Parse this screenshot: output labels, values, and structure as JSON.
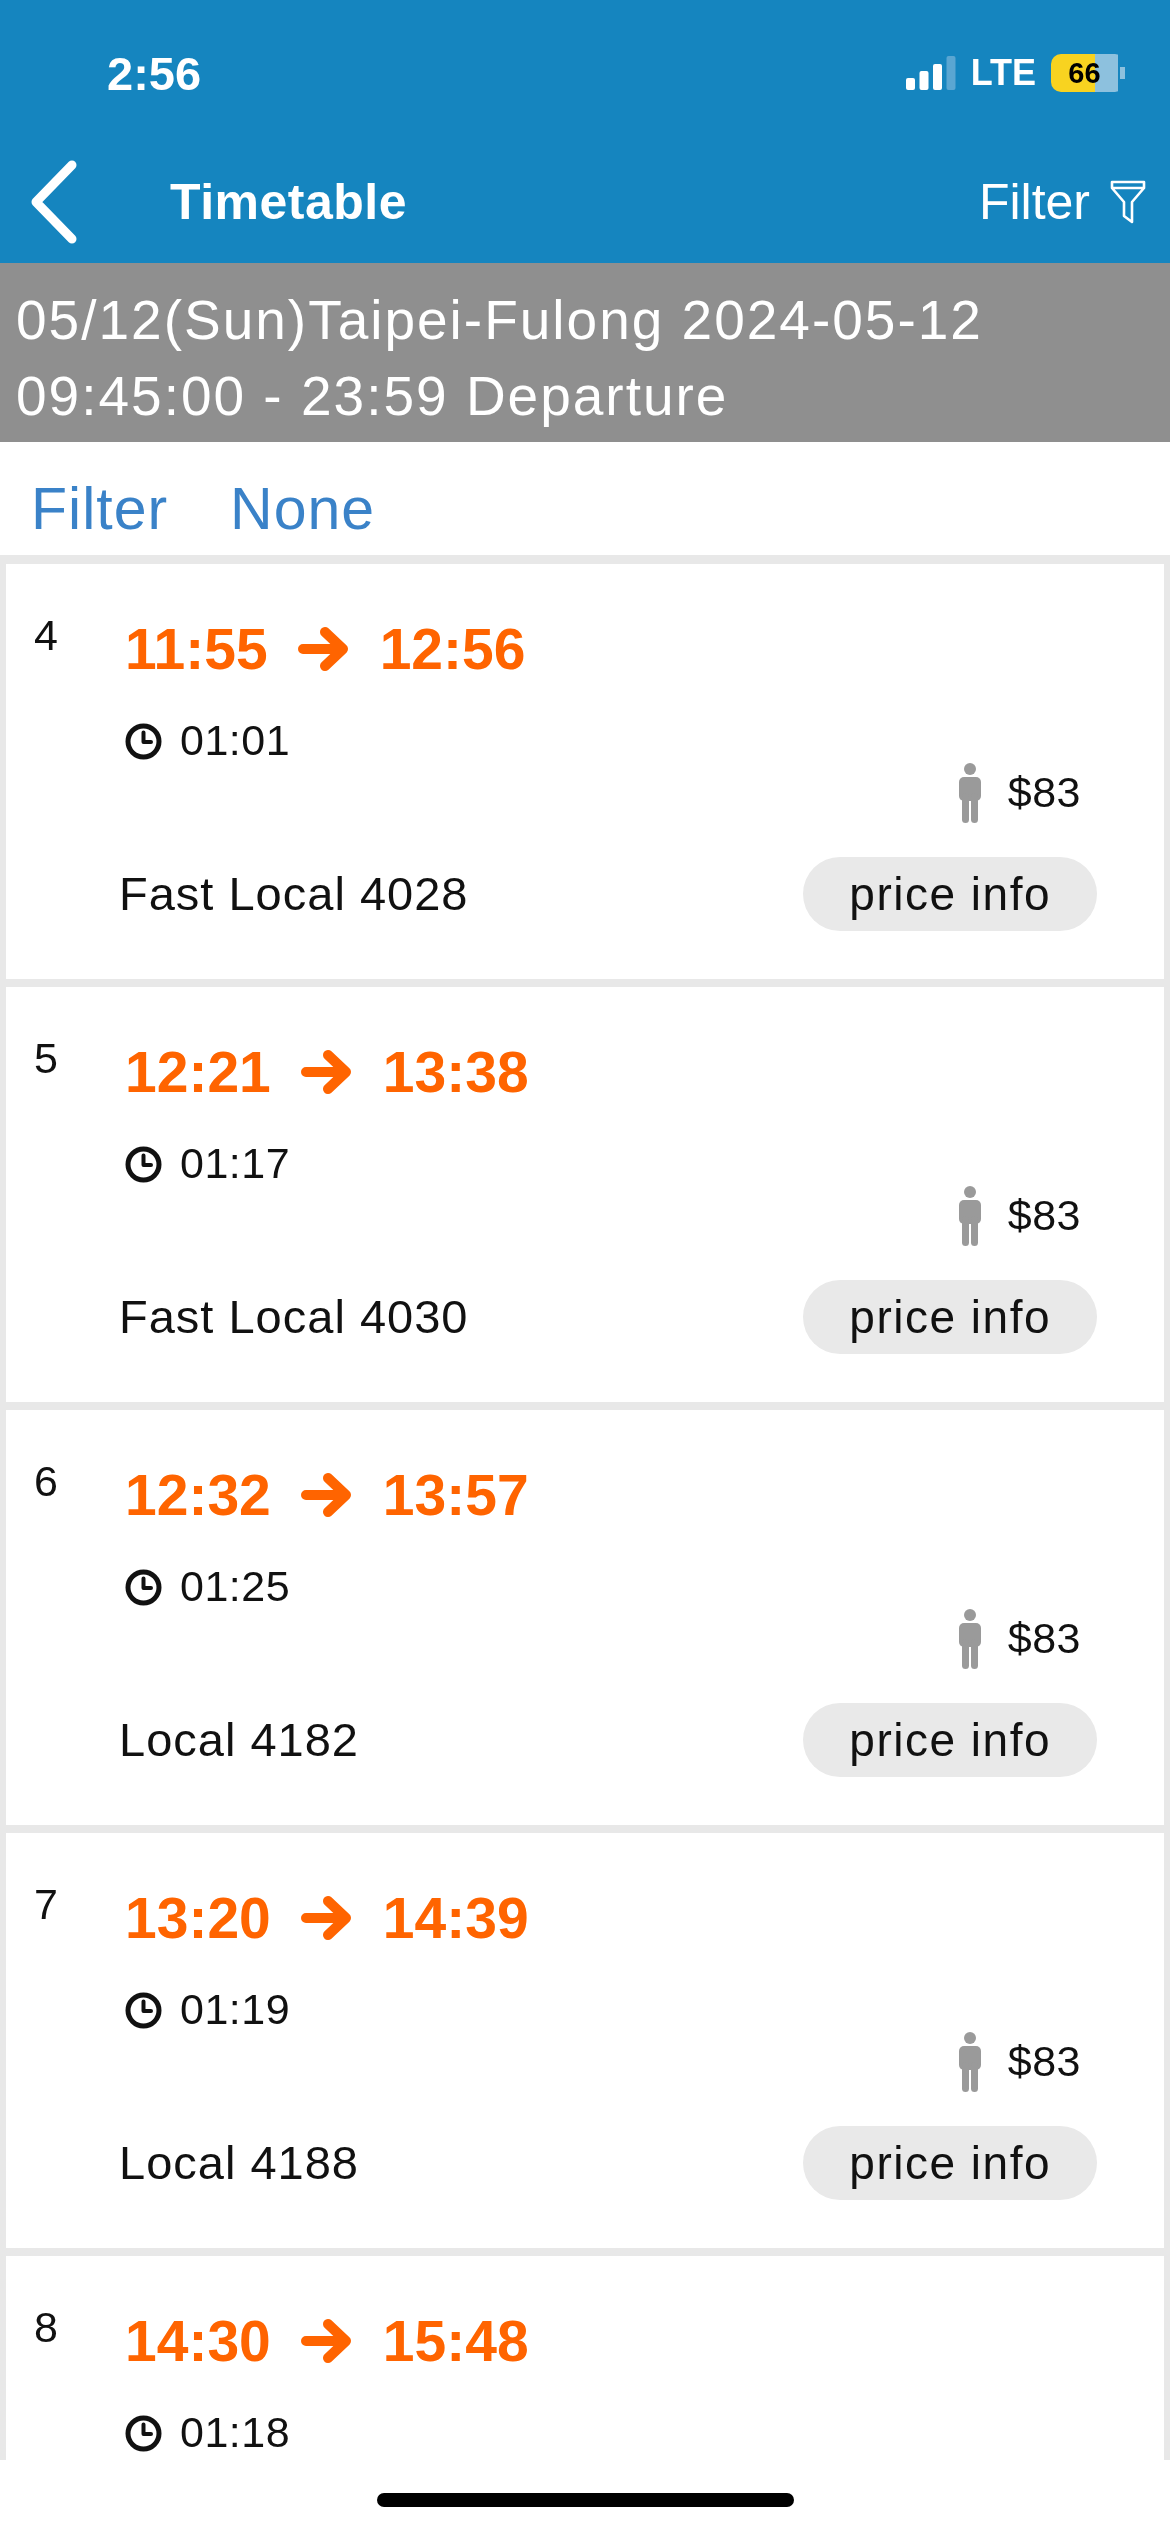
{
  "status_bar": {
    "time": "2:56",
    "network": "LTE",
    "battery": "66"
  },
  "nav_bar": {
    "title": "Timetable",
    "filter": "Filter"
  },
  "banner": {
    "lines": [
      "05/12(Sun)Taipei-Fulong 2024-05-12",
      "09:45:00 - 23:59 Departure"
    ]
  },
  "filter_row": {
    "label": "Filter",
    "value": "None"
  },
  "trains": [
    {
      "index": "4",
      "departure": "11:55",
      "arrival": "12:56",
      "duration": "01:01",
      "fare": "$83",
      "name": "Fast Local 4028",
      "button": "price info"
    },
    {
      "index": "5",
      "departure": "12:21",
      "arrival": "13:38",
      "duration": "01:17",
      "fare": "$83",
      "name": "Fast Local 4030",
      "button": "price info"
    },
    {
      "index": "6",
      "departure": "12:32",
      "arrival": "13:57",
      "duration": "01:25",
      "fare": "$83",
      "name": "Local 4182",
      "button": "price info"
    },
    {
      "index": "7",
      "departure": "13:20",
      "arrival": "14:39",
      "duration": "01:19",
      "fare": "$83",
      "name": "Local 4188",
      "button": "price info"
    },
    {
      "index": "8",
      "departure": "14:30",
      "arrival": "15:48",
      "duration": "01:18"
    }
  ]
}
